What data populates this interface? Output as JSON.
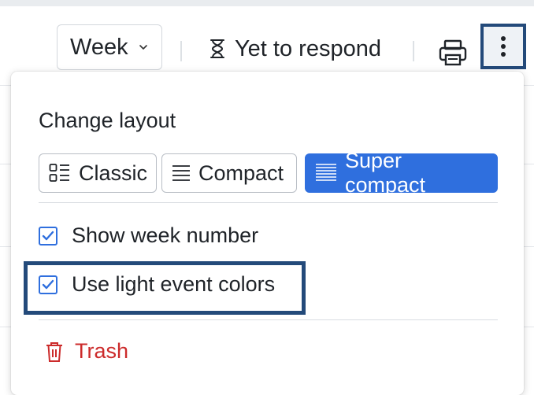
{
  "toolbar": {
    "view_label": "Week",
    "respond_label": "Yet to respond"
  },
  "menu": {
    "section_title": "Change layout",
    "layouts": [
      {
        "label": "Classic",
        "active": false
      },
      {
        "label": "Compact",
        "active": false
      },
      {
        "label": "Super compact",
        "active": true
      }
    ],
    "options": [
      {
        "label": "Show week number",
        "checked": true
      },
      {
        "label": "Use light event colors",
        "checked": true
      }
    ],
    "trash_label": "Trash"
  },
  "colors": {
    "accent": "#2f6fde",
    "highlight_border": "#234a7a",
    "danger": "#cc2b2b"
  },
  "icons": {
    "view_select": "chevron-down-icon",
    "respond": "hourglass-icon",
    "print": "printer-icon",
    "more": "more-vertical-icon",
    "classic": "classic-layout-icon",
    "compact": "compact-layout-icon",
    "super_compact": "super-compact-layout-icon",
    "check": "check-icon",
    "trash": "trash-icon"
  }
}
